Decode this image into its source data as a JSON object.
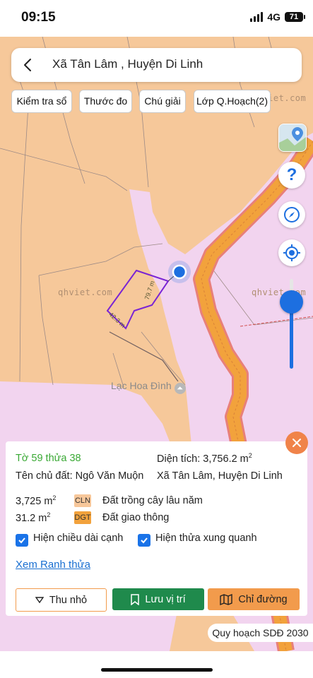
{
  "status": {
    "time": "09:15",
    "network": "4G",
    "battery": "71"
  },
  "header": {
    "title": "Xã Tân Lâm , Huyện Di Linh"
  },
  "chips": [
    {
      "label": "Kiểm tra sổ"
    },
    {
      "label": "Thước đo"
    },
    {
      "label": "Chú giải"
    },
    {
      "label": "Lớp Q.Hoạch(2)"
    }
  ],
  "map": {
    "watermark": "qhviet.com",
    "place_name": "Lạc Hoa Đình",
    "edge_labels": [
      "79.7 m",
      "42.3 m"
    ]
  },
  "parcel": {
    "title": "Tờ 59 thửa 38",
    "area_label": "Diện tích: 3,756.2 m",
    "area_sup": "2",
    "owner": "Tên chủ đất: Ngô Văn Muộn",
    "location": "Xã Tân Lâm, Huyện Di Linh",
    "land_uses": [
      {
        "area": "3,725 m",
        "sup": "2",
        "code": "CLN",
        "name": "Đất trồng cây lâu năm",
        "color": "#f7c79a"
      },
      {
        "area": "31.2 m",
        "sup": "2",
        "code": "DGT",
        "name": "Đất giao thông",
        "color": "#f2a23c"
      }
    ],
    "checkboxes": [
      {
        "label": "Hiện chiều dài cạnh",
        "checked": true
      },
      {
        "label": "Hiện thửa xung quanh",
        "checked": true
      }
    ],
    "view_link": "Xem Ranh thửa"
  },
  "actions": {
    "collapse": "Thu nhỏ",
    "save": "Lưu vị trí",
    "directions": "Chỉ đường"
  },
  "plan_badge": "Quy hoạch SDĐ 2030",
  "colors": {
    "map_base": "#f6c89a",
    "residential_zone": "#f2d4ef",
    "road": "#f2a23c",
    "accent_blue": "#1d6fe0",
    "save_green": "#1f8a4c",
    "directions_orange": "#f29b4c"
  }
}
